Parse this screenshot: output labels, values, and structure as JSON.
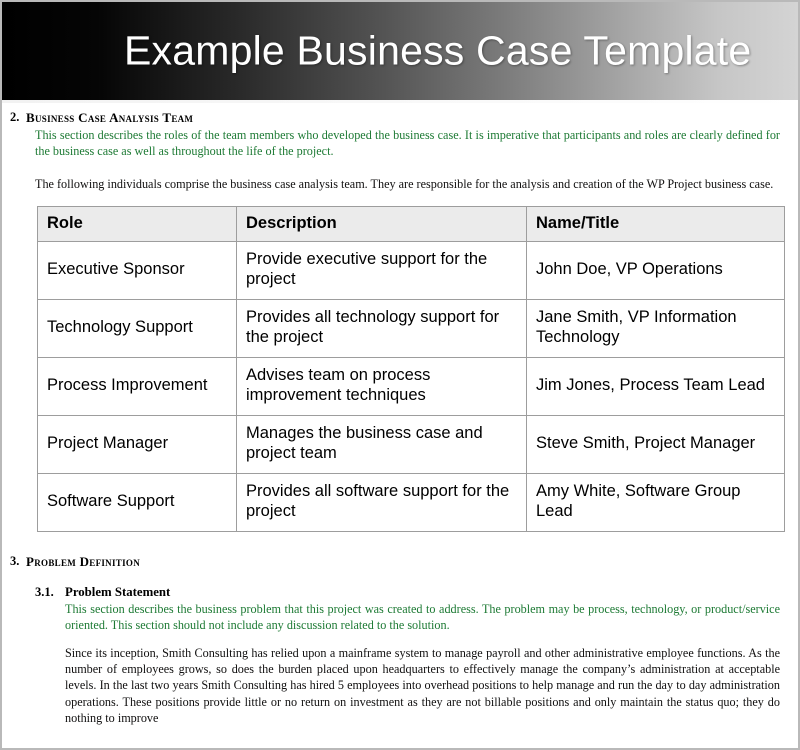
{
  "banner": {
    "title": "Example Business Case Template",
    "gradient_from": "#000000",
    "gradient_to": "#d4d4d4",
    "title_color": "#ffffff"
  },
  "colors": {
    "instruction_green": "#1d7a34",
    "body_black": "#100f0f",
    "table_header_bg": "#ebebeb",
    "table_border": "#9d9d9d",
    "page_border": "#b9b9b9"
  },
  "sections": {
    "business_case_analysis_team": {
      "number": "2.",
      "title": "Business Case Analysis Team",
      "instruction": "This section describes the roles of the team members who developed the business case.  It is imperative that participants and roles are clearly defined for the business case as well as throughout the life of the project.",
      "intro": "The following individuals comprise the business case analysis team.  They are responsible for the analysis and creation of the WP Project business case."
    },
    "problem_definition": {
      "number": "3.",
      "title": "Problem Definition",
      "subsection": {
        "number": "3.1.",
        "title": "Problem Statement",
        "instruction": "This section describes the business problem that this project was created to address.  The problem may be process, technology, or product/service oriented.  This section should not include any discussion related to the solution.",
        "body": "Since its inception, Smith Consulting has relied upon a mainframe system to manage payroll and other administrative employee functions.  As the number of employees grows, so does the burden placed upon headquarters to effectively manage the company’s administration at acceptable levels.  In the last two years Smith Consulting has hired 5 employees into overhead positions to help manage and run the day to day administration operations.  These positions provide little or no return on investment as they are not billable positions and only maintain the status quo; they do nothing to improve"
      }
    }
  },
  "team_table": {
    "headers": [
      "Role",
      "Description",
      "Name/Title"
    ],
    "rows": [
      {
        "role": "Executive Sponsor",
        "description": "Provide executive support for the project",
        "name_title": "John Doe, VP Operations"
      },
      {
        "role": "Technology Support",
        "description": "Provides all technology support for the project",
        "name_title": "Jane Smith, VP Information Technology"
      },
      {
        "role": "Process Improvement",
        "description": "Advises team on process improvement techniques",
        "name_title": "Jim Jones, Process Team Lead"
      },
      {
        "role": "Project Manager",
        "description": "Manages the business case and project team",
        "name_title": "Steve Smith, Project Manager"
      },
      {
        "role": "Software Support",
        "description": "Provides all software support for the project",
        "name_title": "Amy White, Software Group Lead"
      }
    ]
  }
}
